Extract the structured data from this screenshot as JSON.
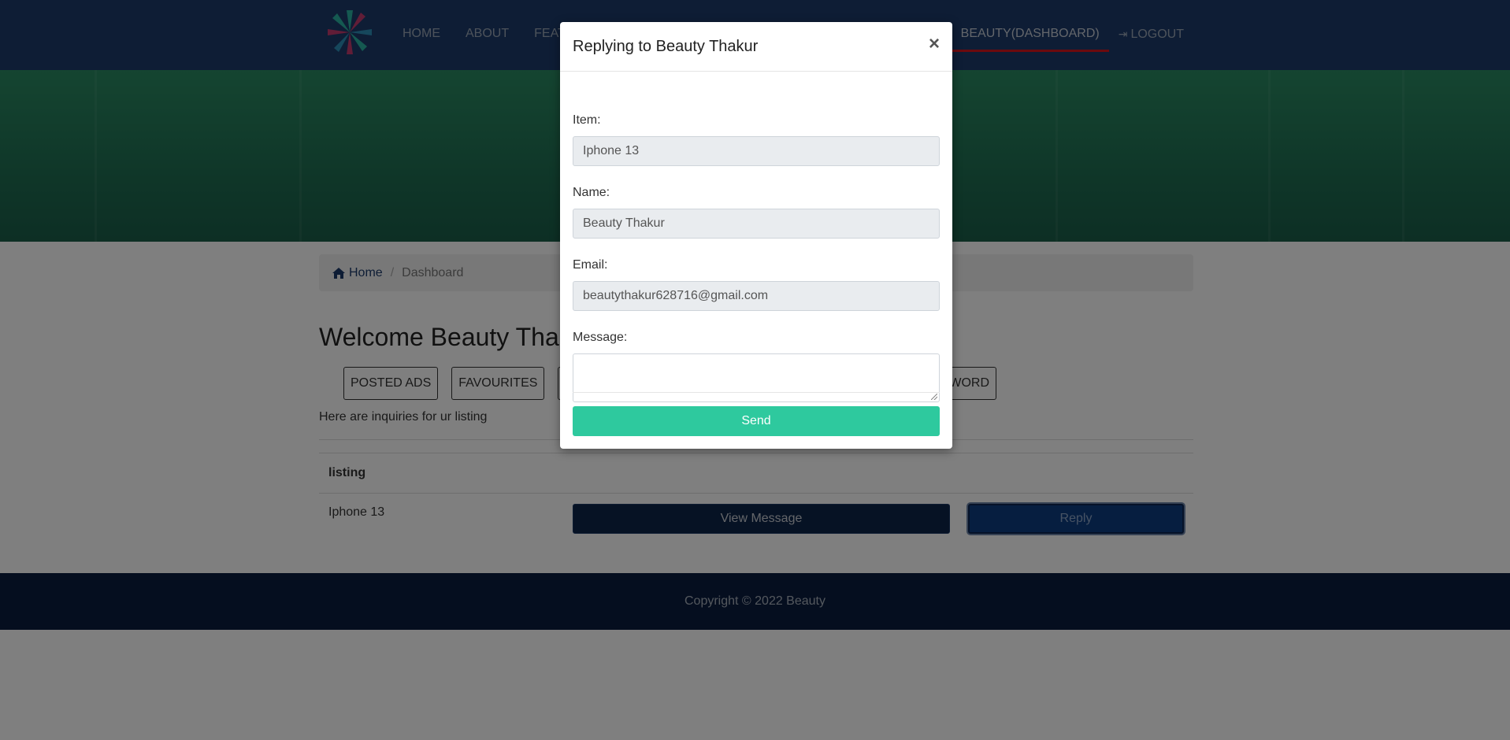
{
  "nav": {
    "links": [
      "HOME",
      "ABOUT",
      "FEATURED"
    ],
    "dashboard": "BEAUTY(DASHBOARD)",
    "logout": "LOGOUT",
    "accent_color": "#d9151c"
  },
  "breadcrumb": {
    "home": "Home",
    "current": "Dashboard"
  },
  "welcome": "Welcome Beauty Thakur",
  "tabs": {
    "posted_ads": "POSTED ADS",
    "favourites": "FAVOURITES",
    "password_fragment": "SWORD"
  },
  "inquiries_text": "Here are inquiries for ur listing",
  "table": {
    "header": "listing",
    "rows": [
      {
        "listing": "Iphone 13",
        "view": "View Message",
        "reply": "Reply"
      }
    ]
  },
  "footer": "Copyright © 2022 Beauty",
  "modal": {
    "title": "Replying to Beauty Thakur",
    "close": "×",
    "item_label": "Item:",
    "item_value": "Iphone 13",
    "name_label": "Name:",
    "name_value": "Beauty Thakur",
    "email_label": "Email:",
    "email_value": "beautythakur628716@gmail.com",
    "message_label": "Message:",
    "message_value": "",
    "send": "Send",
    "send_color": "#2ec99e"
  }
}
